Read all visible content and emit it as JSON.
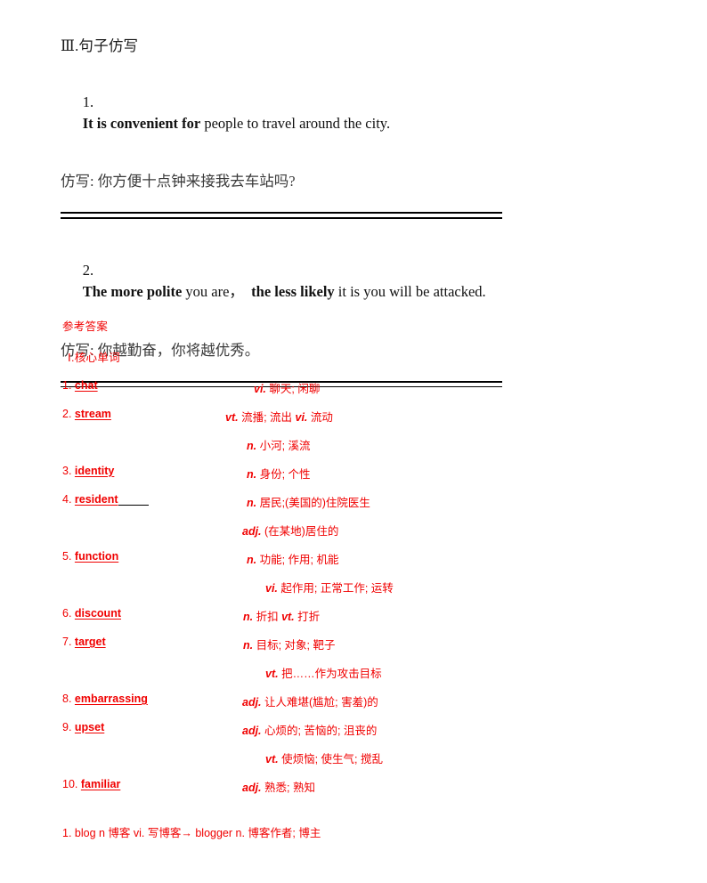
{
  "document": {
    "section_heading": "Ⅲ.句子仿写",
    "exercises": [
      {
        "number": "1.",
        "bold_part": "It is convenient for",
        "rest": " people to travel around the city.",
        "imitate_label": "仿写:",
        "imitate_text": "你方便十点钟来接我去车站吗?"
      },
      {
        "number": "2.",
        "bold_part": "The more polite",
        "mid": " you are，",
        "bold_part2": "the less likely",
        "rest": " it is you will be attacked.",
        "imitate_label": "仿写:",
        "imitate_text": "你越勤奋，你将越优秀。"
      }
    ],
    "answer_key": {
      "title": "参考答案",
      "subtitle": "Ⅰ.核心单词",
      "entries": [
        {
          "num": "1.",
          "word": "chat",
          "pad": false,
          "lines": [
            {
              "pos": "vi.",
              "meaning": "聊天; 闲聊",
              "indent": 215
            }
          ]
        },
        {
          "num": "2.",
          "word": "stream",
          "pad": false,
          "lines": [
            {
              "pos": "vt.",
              "meaning": "流播;  流出 ",
              "pos2": "vi.",
              "meaning2": "流动",
              "indent": 183
            },
            {
              "pos": "n.",
              "meaning": "小河; 溪流",
              "indent": 207
            }
          ]
        },
        {
          "num": "3.",
          "word": "identity",
          "pad": false,
          "lines": [
            {
              "pos": "n.",
              "meaning": "身份; 个性",
              "indent": 207
            }
          ]
        },
        {
          "num": "4.",
          "word": "resident",
          "pad": true,
          "lines": [
            {
              "pos": "n.",
              "meaning": "居民;(美国的)住院医生",
              "indent": 207
            },
            {
              "pos": "adj.",
              "meaning": "(在某地)居住的",
              "indent": 202
            }
          ]
        },
        {
          "num": "5.",
          "word": "function",
          "pad": false,
          "lines": [
            {
              "pos": "n.",
              "meaning": "功能; 作用; 机能",
              "indent": 207
            },
            {
              "pos": "vi.",
              "meaning": "起作用; 正常工作; 运转",
              "indent": 228
            }
          ]
        },
        {
          "num": "6.",
          "word": "discount",
          "pad": false,
          "lines": [
            {
              "pos": "n.",
              "meaning": "折扣 ",
              "pos2": "vt.",
              "meaning2": "打折",
              "indent": 203
            }
          ]
        },
        {
          "num": "7.",
          "word": "target",
          "pad": false,
          "lines": [
            {
              "pos": "n.",
              "meaning": "目标; 对象; 靶子",
              "indent": 203
            },
            {
              "pos": "vt.",
              "meaning": "把……作为攻击目标",
              "indent": 228
            }
          ]
        },
        {
          "num": "8.",
          "word": "embarrassing",
          "pad": false,
          "lines": [
            {
              "pos": "adj.",
              "meaning": "让人难堪(尴尬; 害羞)的",
              "indent": 202
            }
          ]
        },
        {
          "num": "9.",
          "word": "upset",
          "pad": false,
          "lines": [
            {
              "pos": "adj.",
              "meaning": "心烦的; 苦恼的; 沮丧的",
              "indent": 202
            },
            {
              "pos": "vt.",
              "meaning": "使烦恼; 使生气; 搅乱",
              "indent": 228
            }
          ]
        },
        {
          "num": "10.",
          "word": "familiar",
          "pad": false,
          "lines": [
            {
              "pos": "adj.",
              "meaning": "熟悉; 熟知",
              "indent": 202
            }
          ]
        }
      ]
    },
    "extra_note": "1. blog n  博客  vi. 写博客→ blogger n.  博客作者; 博主"
  },
  "colors": {
    "answer_red": "#f00000",
    "body_black": "#000000"
  }
}
